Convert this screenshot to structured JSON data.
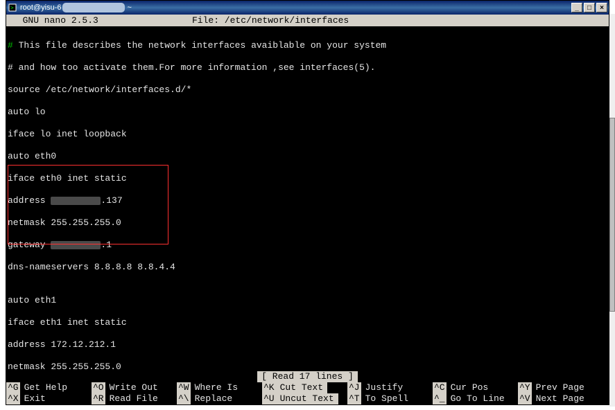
{
  "window": {
    "title_prefix": "root@yisu-6",
    "title_suffix": "~"
  },
  "nano_header": {
    "editor": "  GNU nano 2.5.3",
    "file_label": "File: /etc/network/interfaces"
  },
  "file_lines": {
    "l0_hash": "#",
    "l0_rest": " This file describes the network interfaces avaiblable on your system",
    "l1": "# and how too activate them.For more information ,see interfaces(5).",
    "l2": "source /etc/network/interfaces.d/*",
    "l3": "auto lo",
    "l4": "iface lo inet loopback",
    "l5": "auto eth0",
    "l6": "iface eth0 inet static",
    "l7_pre": "address ",
    "l7_post": ".137",
    "l8": "netmask 255.255.255.0",
    "l9_pre": "gateway ",
    "l9_post": ".1",
    "l10": "dns-nameservers 8.8.8.8 8.8.4.4",
    "l11": "",
    "l12": "auto eth1",
    "l13": "iface eth1 inet static",
    "l14": "address 172.12.212.1",
    "l15": "netmask 255.255.255.0"
  },
  "status": {
    "text": "[ Read 17 lines ]"
  },
  "shortcuts": {
    "r1": [
      {
        "key": "^G",
        "label": "Get Help",
        "hl": false
      },
      {
        "key": "^O",
        "label": "Write Out",
        "hl": false
      },
      {
        "key": "^W",
        "label": "Where Is",
        "hl": false
      },
      {
        "key": "^K",
        "label": "Cut Text",
        "hl": true
      },
      {
        "key": "^J",
        "label": "Justify",
        "hl": false
      },
      {
        "key": "^C",
        "label": "Cur Pos",
        "hl": false
      },
      {
        "key": "^Y",
        "label": "Prev Page",
        "hl": false
      }
    ],
    "r2": [
      {
        "key": "^X",
        "label": "Exit",
        "hl": false
      },
      {
        "key": "^R",
        "label": "Read File",
        "hl": false
      },
      {
        "key": "^\\",
        "label": "Replace",
        "hl": false
      },
      {
        "key": "^U",
        "label": "Uncut Text",
        "hl": true
      },
      {
        "key": "^T",
        "label": "To Spell",
        "hl": false
      },
      {
        "key": "^_",
        "label": "Go To Line",
        "hl": false
      },
      {
        "key": "^V",
        "label": "Next Page",
        "hl": false
      }
    ]
  }
}
